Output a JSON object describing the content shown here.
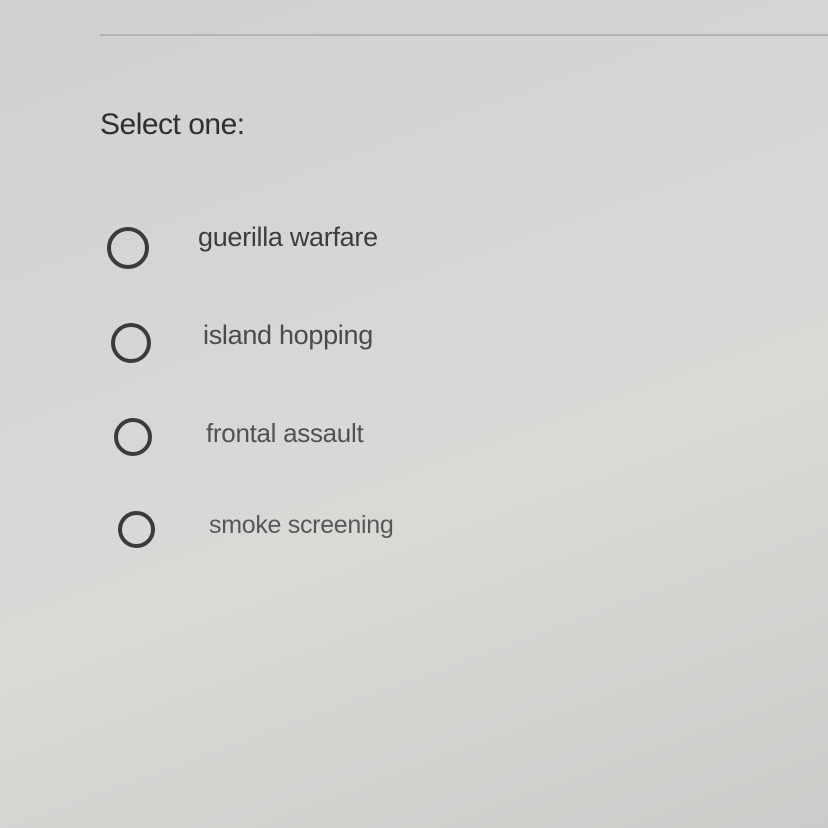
{
  "question": {
    "prompt": "Select one:",
    "options": [
      {
        "label": "guerilla warfare",
        "selected": false
      },
      {
        "label": "island hopping",
        "selected": false
      },
      {
        "label": "frontal assault",
        "selected": false
      },
      {
        "label": "smoke screening",
        "selected": false
      }
    ]
  },
  "colors": {
    "background": "#d6d7d5",
    "text": "#3c3d3e",
    "radio_border": "#3a3b3c",
    "rule": "#b3b5b4"
  }
}
